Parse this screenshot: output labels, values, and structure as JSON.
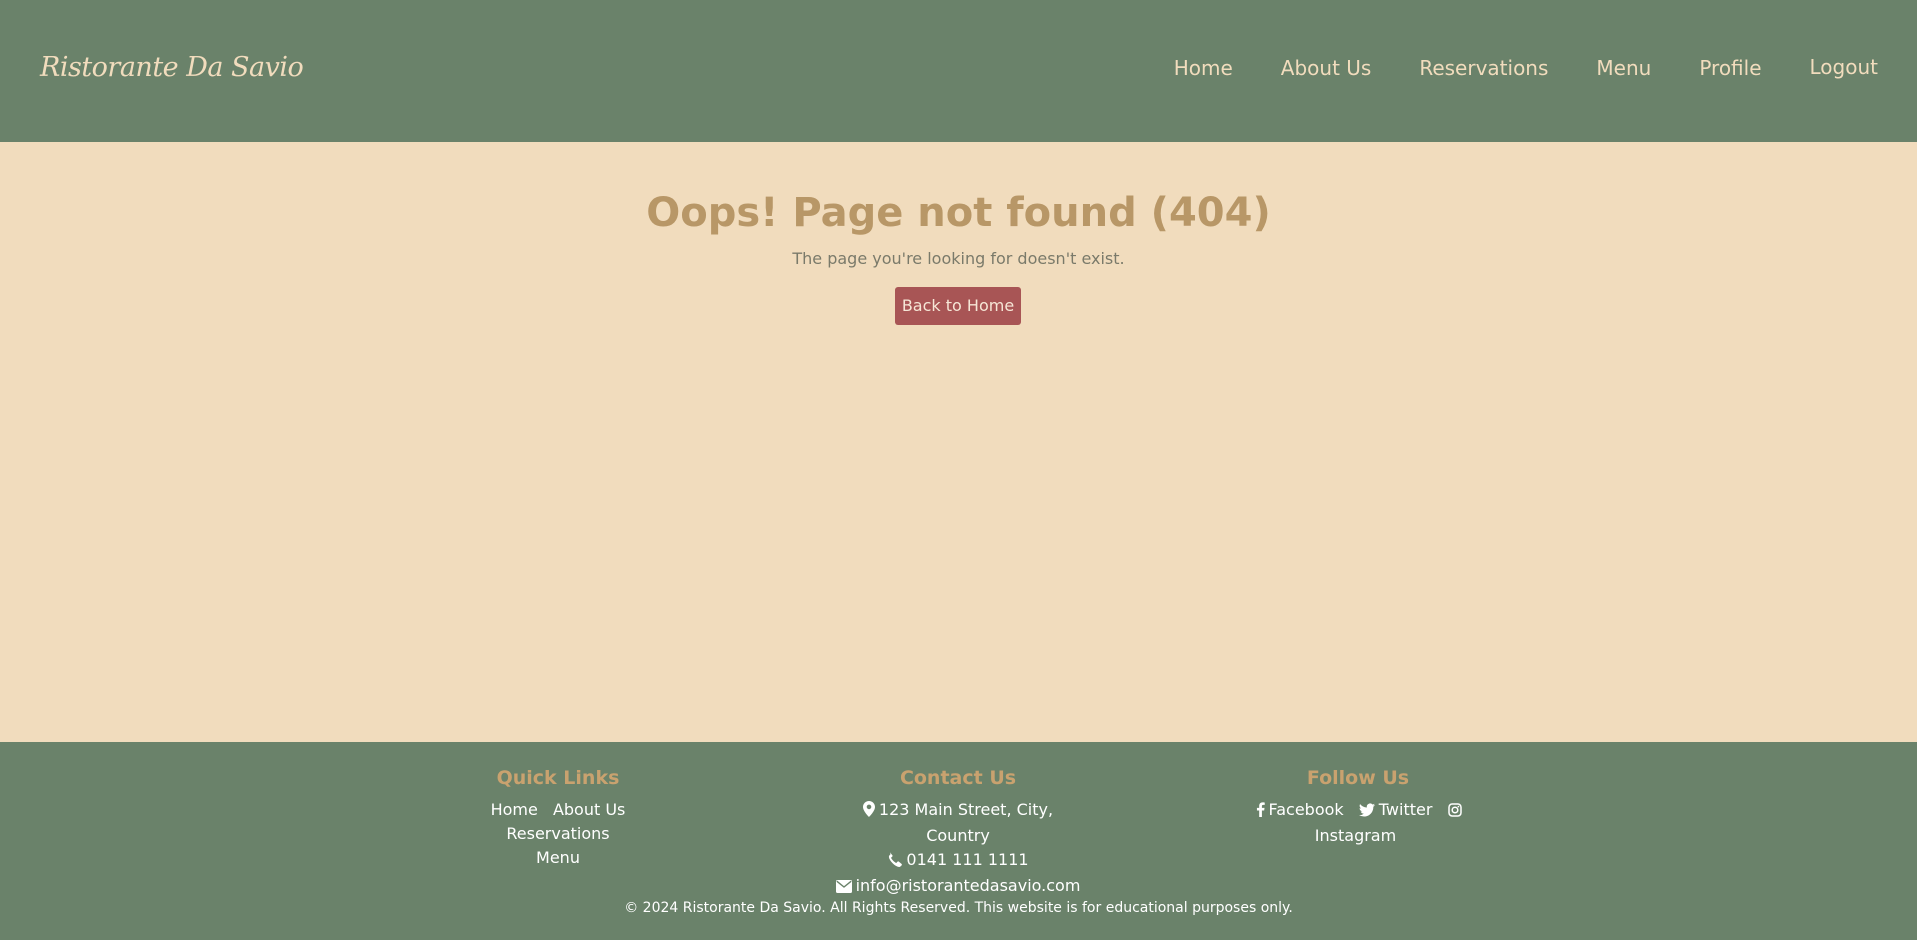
{
  "brand": {
    "name": "Ristorante Da Savio"
  },
  "nav": {
    "items": [
      {
        "label": "Home"
      },
      {
        "label": "About Us"
      },
      {
        "label": "Reservations"
      },
      {
        "label": "Menu"
      },
      {
        "label": "Profile"
      },
      {
        "label": "Logout"
      }
    ]
  },
  "error": {
    "title": "Oops! Page not found (404)",
    "message": "The page you're looking for doesn't exist.",
    "button_label": "Back to Home"
  },
  "footer": {
    "quick_links": {
      "heading": "Quick Links",
      "links": [
        "Home",
        "About Us",
        "Reservations",
        "Menu"
      ]
    },
    "contact": {
      "heading": "Contact Us",
      "address": "123 Main Street, City, Country",
      "phone": "0141 111 1111",
      "email": "info@ristorantedasavio.com",
      "icons": [
        "map-marker-icon",
        "phone-icon",
        "envelope-icon"
      ]
    },
    "follow": {
      "heading": "Follow Us",
      "items": [
        {
          "label": "Facebook",
          "icon": "facebook-icon"
        },
        {
          "label": "Twitter",
          "icon": "twitter-icon"
        },
        {
          "label": "Instagram",
          "icon": "instagram-icon"
        }
      ]
    },
    "copyright": "© 2024 Ristorante Da Savio. All Rights Reserved. This website is for educational purposes only."
  },
  "colors": {
    "navbar_bg": "#6a826a",
    "page_bg": "#f1dcbd",
    "title": "#b89767",
    "button_bg": "#a85555",
    "footer_heading": "#c9a26f"
  }
}
